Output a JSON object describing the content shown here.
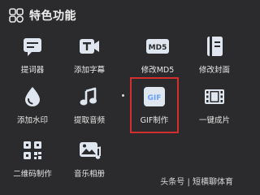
{
  "header": {
    "title": "特色功能"
  },
  "features": [
    {
      "label": "提词器",
      "icon": "teleprompter-icon"
    },
    {
      "label": "添加字幕",
      "icon": "add-subtitle-icon"
    },
    {
      "label": "修改MD5",
      "icon": "md5-icon",
      "badge": "MD5"
    },
    {
      "label": "修改封面",
      "icon": "cover-icon"
    },
    {
      "label": "添加水印",
      "icon": "watermark-drop-icon"
    },
    {
      "label": "提取音频",
      "icon": "extract-audio-icon"
    },
    {
      "label": "GIF制作",
      "icon": "gif-icon",
      "badge": "GIF",
      "selected": true
    },
    {
      "label": "一键成片",
      "icon": "film-strip-icon"
    },
    {
      "label": "二维码制作",
      "icon": "qr-code-icon"
    },
    {
      "label": "音乐相册",
      "icon": "music-album-icon"
    }
  ],
  "watermark": "头条号 | 短横聊体育",
  "colors": {
    "accent": "#dfe6f0",
    "highlight": "#d32f2f",
    "gif_blue": "#6aa0ff",
    "background": "#2b2b2d"
  }
}
